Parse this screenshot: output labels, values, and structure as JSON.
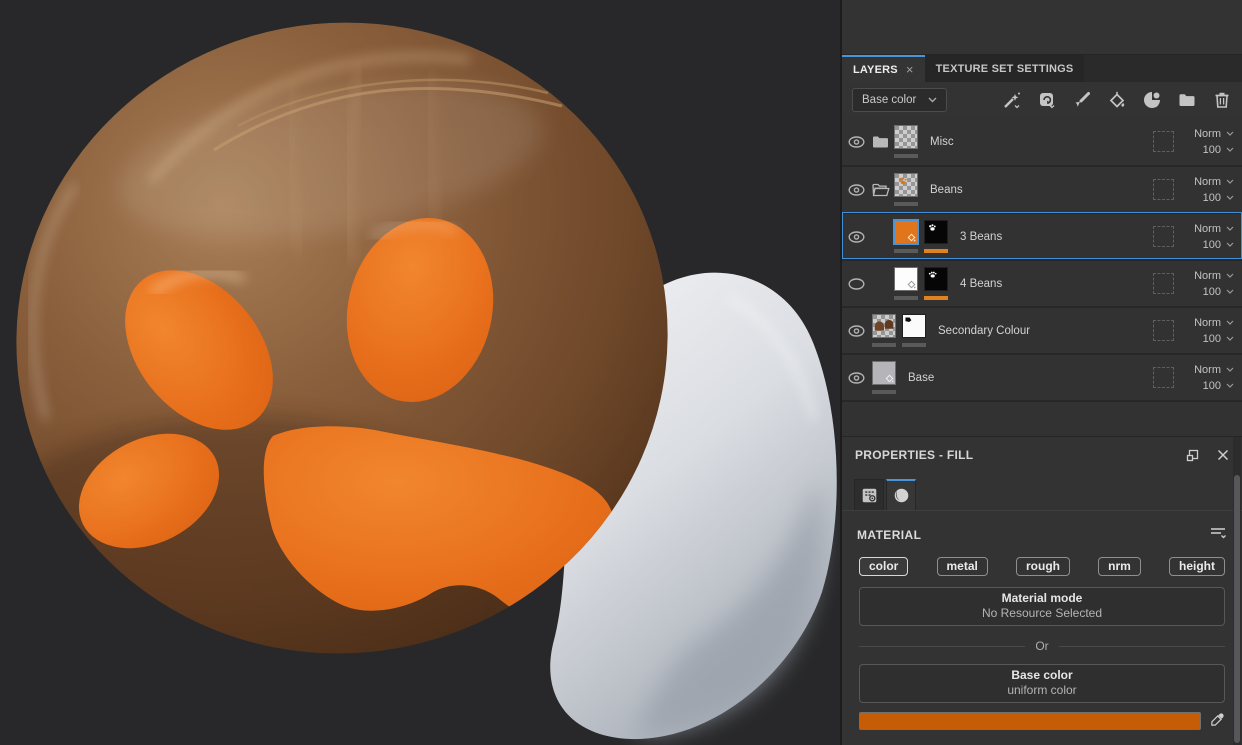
{
  "viewport": {
    "description": "3D view of chocolate paw-pad model with orange paw print and white inner shell",
    "colors": {
      "background": "#28282a",
      "shell": "#8a5f3c",
      "pads": "#e8701c",
      "inner": "#d9dce1"
    }
  },
  "layers_panel": {
    "tabs": [
      {
        "label": "LAYERS",
        "close": "×",
        "active": true
      },
      {
        "label": "TEXTURE SET SETTINGS",
        "active": false
      }
    ],
    "channel_select": {
      "value": "Base color"
    },
    "toolbar_icons": [
      "magic-wand",
      "add-smart-material",
      "paint-brush",
      "paint-bucket",
      "material-sphere",
      "add-folder",
      "trash"
    ],
    "layers": [
      {
        "name": "Misc",
        "type": "group",
        "visible": true,
        "blend": "Norm",
        "opacity": "100"
      },
      {
        "name": "Beans",
        "type": "group",
        "visible": true,
        "blend": "Norm",
        "opacity": "100"
      },
      {
        "name": "3 Beans",
        "type": "fill",
        "visible": true,
        "selected": true,
        "fill_hex": "#e0751c",
        "blend": "Norm",
        "opacity": "100"
      },
      {
        "name": "4 Beans",
        "type": "fill",
        "visible": false,
        "fill_hex": "#ffffff",
        "blend": "Norm",
        "opacity": "100"
      },
      {
        "name": "Secondary Colour",
        "type": "paint",
        "visible": true,
        "blend": "Norm",
        "opacity": "100"
      },
      {
        "name": "Base",
        "type": "fill",
        "visible": true,
        "fill_hex": "#b4b4b9",
        "blend": "Norm",
        "opacity": "100"
      }
    ]
  },
  "properties_panel": {
    "title": "PROPERTIES - FILL",
    "material_section": "MATERIAL",
    "channels": [
      {
        "label": "color",
        "active": true
      },
      {
        "label": "metal"
      },
      {
        "label": "rough"
      },
      {
        "label": "nrm"
      },
      {
        "label": "height"
      }
    ],
    "material_mode": {
      "title": "Material mode",
      "subtitle": "No Resource Selected"
    },
    "or_label": "Or",
    "base_color": {
      "title": "Base color",
      "subtitle": "uniform color",
      "swatch_hex": "#c75c07"
    }
  },
  "accent": {
    "blue": "#4a94d9",
    "orange": "#e8701c"
  }
}
